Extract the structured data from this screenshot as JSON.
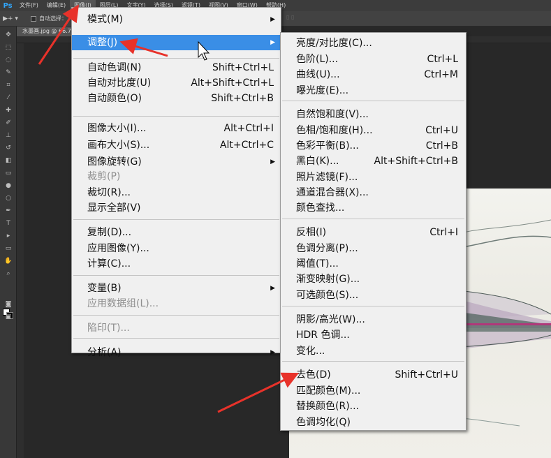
{
  "menubar": {
    "logo": "Ps",
    "items": [
      "文件(F)",
      "编辑(E)",
      "图像(I)",
      "图层(L)",
      "文字(Y)",
      "选择(S)",
      "滤镜(T)",
      "视图(V)",
      "窗口(W)",
      "帮助(H)"
    ]
  },
  "options": {
    "tool_glyph": "▶+ ▾",
    "auto_select_label": "自动选择："
  },
  "document": {
    "tab_title": "水墨画.jpg @ 66.7%"
  },
  "image_menu": {
    "items": [
      {
        "label": "模式(M)",
        "shortcut": "",
        "submenu": true,
        "disabled": false
      },
      {
        "label": "调整(J)",
        "shortcut": "",
        "submenu": true,
        "disabled": false,
        "highlighted": true
      },
      {
        "label": "自动色调(N)",
        "shortcut": "Shift+Ctrl+L",
        "submenu": false,
        "disabled": false
      },
      {
        "label": "自动对比度(U)",
        "shortcut": "Alt+Shift+Ctrl+L",
        "submenu": false,
        "disabled": false
      },
      {
        "label": "自动颜色(O)",
        "shortcut": "Shift+Ctrl+B",
        "submenu": false,
        "disabled": false
      },
      {
        "label": "图像大小(I)...",
        "shortcut": "Alt+Ctrl+I",
        "submenu": false,
        "disabled": false
      },
      {
        "label": "画布大小(S)...",
        "shortcut": "Alt+Ctrl+C",
        "submenu": false,
        "disabled": false
      },
      {
        "label": "图像旋转(G)",
        "shortcut": "",
        "submenu": true,
        "disabled": false
      },
      {
        "label": "裁剪(P)",
        "shortcut": "",
        "submenu": false,
        "disabled": true
      },
      {
        "label": "裁切(R)...",
        "shortcut": "",
        "submenu": false,
        "disabled": false
      },
      {
        "label": "显示全部(V)",
        "shortcut": "",
        "submenu": false,
        "disabled": false
      },
      {
        "label": "复制(D)...",
        "shortcut": "",
        "submenu": false,
        "disabled": false
      },
      {
        "label": "应用图像(Y)...",
        "shortcut": "",
        "submenu": false,
        "disabled": false
      },
      {
        "label": "计算(C)...",
        "shortcut": "",
        "submenu": false,
        "disabled": false
      },
      {
        "label": "变量(B)",
        "shortcut": "",
        "submenu": true,
        "disabled": false
      },
      {
        "label": "应用数据组(L)...",
        "shortcut": "",
        "submenu": false,
        "disabled": true
      },
      {
        "label": "陷印(T)...",
        "shortcut": "",
        "submenu": false,
        "disabled": true
      },
      {
        "label": "分析(A)",
        "shortcut": "",
        "submenu": true,
        "disabled": false
      }
    ]
  },
  "adjust_menu": {
    "items": [
      {
        "label": "亮度/对比度(C)...",
        "shortcut": ""
      },
      {
        "label": "色阶(L)...",
        "shortcut": "Ctrl+L"
      },
      {
        "label": "曲线(U)...",
        "shortcut": "Ctrl+M"
      },
      {
        "label": "曝光度(E)...",
        "shortcut": ""
      },
      {
        "label": "自然饱和度(V)...",
        "shortcut": ""
      },
      {
        "label": "色相/饱和度(H)...",
        "shortcut": "Ctrl+U"
      },
      {
        "label": "色彩平衡(B)...",
        "shortcut": "Ctrl+B"
      },
      {
        "label": "黑白(K)...",
        "shortcut": "Alt+Shift+Ctrl+B"
      },
      {
        "label": "照片滤镜(F)...",
        "shortcut": ""
      },
      {
        "label": "通道混合器(X)...",
        "shortcut": ""
      },
      {
        "label": "颜色查找...",
        "shortcut": ""
      },
      {
        "label": "反相(I)",
        "shortcut": "Ctrl+I"
      },
      {
        "label": "色调分离(P)...",
        "shortcut": ""
      },
      {
        "label": "阈值(T)...",
        "shortcut": ""
      },
      {
        "label": "渐变映射(G)...",
        "shortcut": ""
      },
      {
        "label": "可选颜色(S)...",
        "shortcut": ""
      },
      {
        "label": "阴影/高光(W)...",
        "shortcut": ""
      },
      {
        "label": "HDR 色调...",
        "shortcut": ""
      },
      {
        "label": "变化...",
        "shortcut": ""
      },
      {
        "label": "去色(D)",
        "shortcut": "Shift+Ctrl+U"
      },
      {
        "label": "匹配颜色(M)...",
        "shortcut": ""
      },
      {
        "label": "替换颜色(R)...",
        "shortcut": ""
      },
      {
        "label": "色调均化(Q)",
        "shortcut": ""
      }
    ]
  },
  "colors": {
    "highlight": "#3a8ee6",
    "annotation": "#e8322a",
    "menu_bg": "#f0f0f0"
  },
  "icons": {
    "submenu_arrow": "▶",
    "cursor": "mouse-pointer-icon"
  }
}
